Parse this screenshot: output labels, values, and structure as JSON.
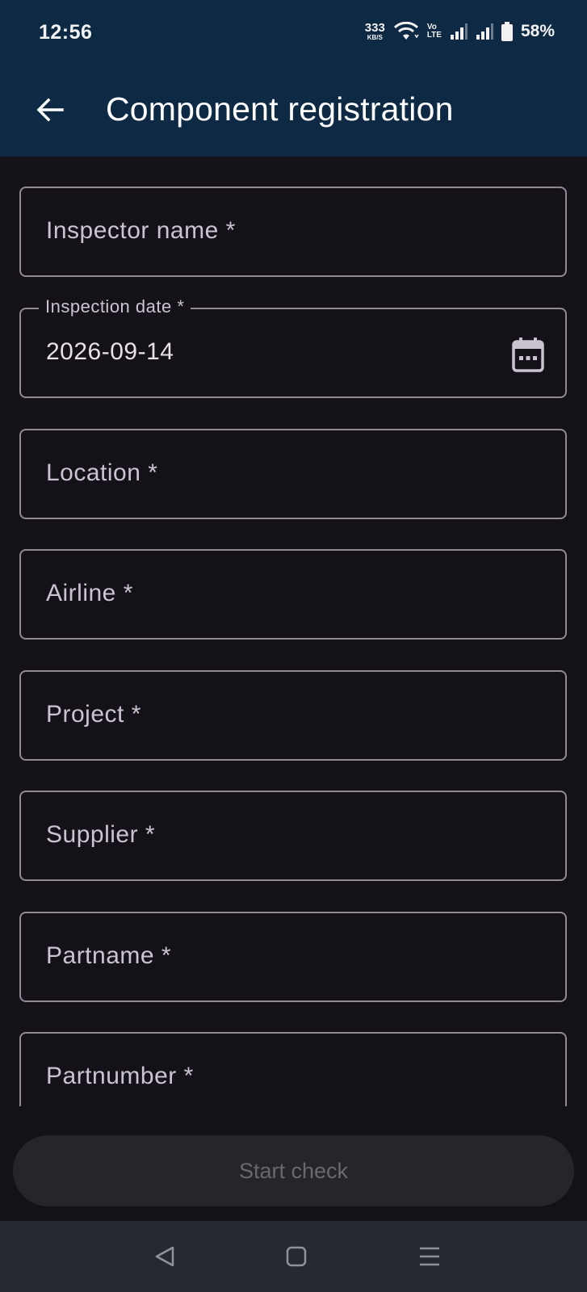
{
  "status_bar": {
    "time": "12:56",
    "speed_value": "333",
    "speed_unit": "KB/S",
    "volte_top": "Vo",
    "volte_bottom": "LTE",
    "battery": "58%"
  },
  "app_bar": {
    "title": "Component registration",
    "back_icon": "arrow-back-icon",
    "background": "#0d2944"
  },
  "form": {
    "fields": [
      {
        "label": "Inspector name *",
        "value": ""
      },
      {
        "label": "Inspection date *",
        "value": "2026-09-14",
        "icon": "calendar-icon"
      },
      {
        "label": "Location *",
        "value": ""
      },
      {
        "label": "Airline *",
        "value": ""
      },
      {
        "label": "Project *",
        "value": ""
      },
      {
        "label": "Supplier *",
        "value": ""
      },
      {
        "label": "Partname *",
        "value": ""
      },
      {
        "label": "Partnumber *",
        "value": ""
      }
    ]
  },
  "actions": {
    "start_label": "Start check",
    "start_enabled": false
  },
  "nav_bar": {
    "back": "triangle-back-icon",
    "home": "square-home-icon",
    "recents": "menu-recents-icon"
  }
}
